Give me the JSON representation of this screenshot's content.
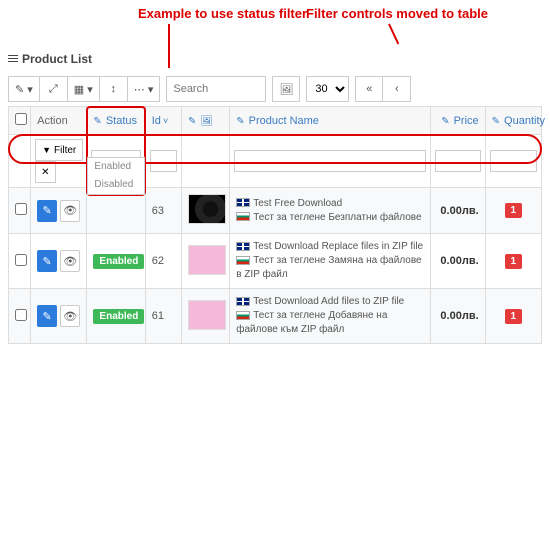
{
  "panel_title": "Product List",
  "annotations": {
    "status_filter": "Example to use status filter",
    "filter_moved": "Filter controls moved to table"
  },
  "toolbar": {
    "search_placeholder": "Search",
    "page_size": "30"
  },
  "columns": {
    "action": "Action",
    "status": "Status",
    "id": "Id",
    "image": "",
    "name": "Product Name",
    "price": "Price",
    "quantity": "Quantity"
  },
  "filter_row": {
    "filter_label": "Filter",
    "status_options": [
      "Enabled",
      "Disabled"
    ]
  },
  "rows": [
    {
      "status": "",
      "id": "63",
      "thumb": "cam",
      "name_en": "Test Free Download",
      "name_bg": "Тест за теглене Безплатни файлове",
      "price": "0.00лв.",
      "qty": "1"
    },
    {
      "status": "Enabled",
      "id": "62",
      "thumb": "pink",
      "name_en": "Test Download Replace files in ZIP file",
      "name_bg": "Тест за теглене Замяна на файлове в ZIP файл",
      "price": "0.00лв.",
      "qty": "1"
    },
    {
      "status": "Enabled",
      "id": "61",
      "thumb": "pink",
      "name_en": "Test Download Add files to ZIP file",
      "name_bg": "Тест за теглене Добавяне на файлове към ZIP файл",
      "price": "0.00лв.",
      "qty": "1"
    }
  ],
  "chart_data": null
}
